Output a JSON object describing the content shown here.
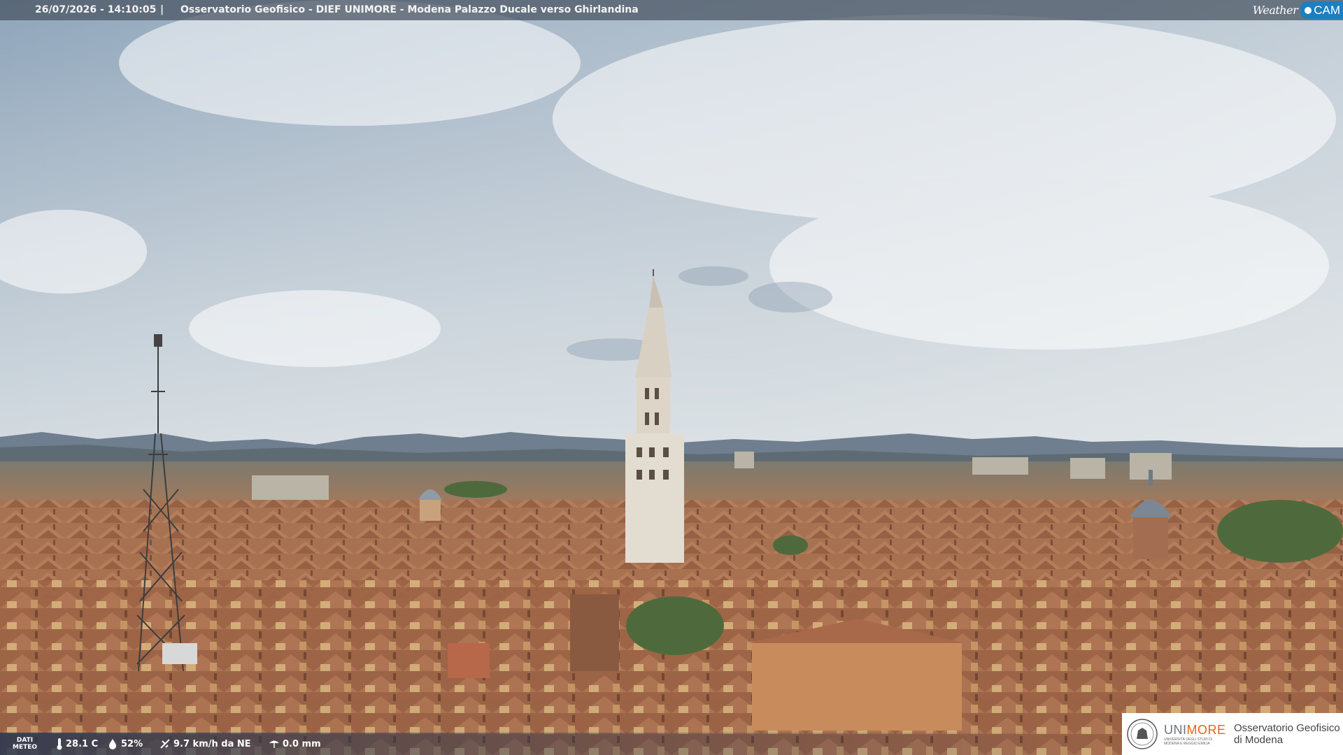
{
  "header": {
    "timestamp": "26/07/2026 - 14:10:05",
    "separator": "|",
    "title": "Osservatorio Geofisico - DIEF UNIMORE - Modena Palazzo Ducale verso Ghirlandina"
  },
  "brand_logo": {
    "weather": "Weather",
    "cam": "CAM"
  },
  "weather_data": {
    "label_line1": "DATI",
    "label_line2": "METEO",
    "temperature": "28.1 C",
    "humidity": "52%",
    "wind": "9.7 km/h da NE",
    "rain": "0.0 mm",
    "icons": [
      "thermometer-icon",
      "humidity-icon",
      "wind-icon",
      "rain-icon"
    ]
  },
  "institution": {
    "uni_grey": "UNI",
    "uni_orange": "MORE",
    "uni_sub": "UNIVERSITÀ DEGLI STUDI DI MODENA E REGGIO EMILIA",
    "obs_line1": "Osservatorio Geofisico",
    "obs_line2": "di Modena"
  },
  "colors": {
    "accent_orange": "#e2641b",
    "weathercam_blue": "#1b7fc0",
    "bar_bg": "#465260"
  }
}
